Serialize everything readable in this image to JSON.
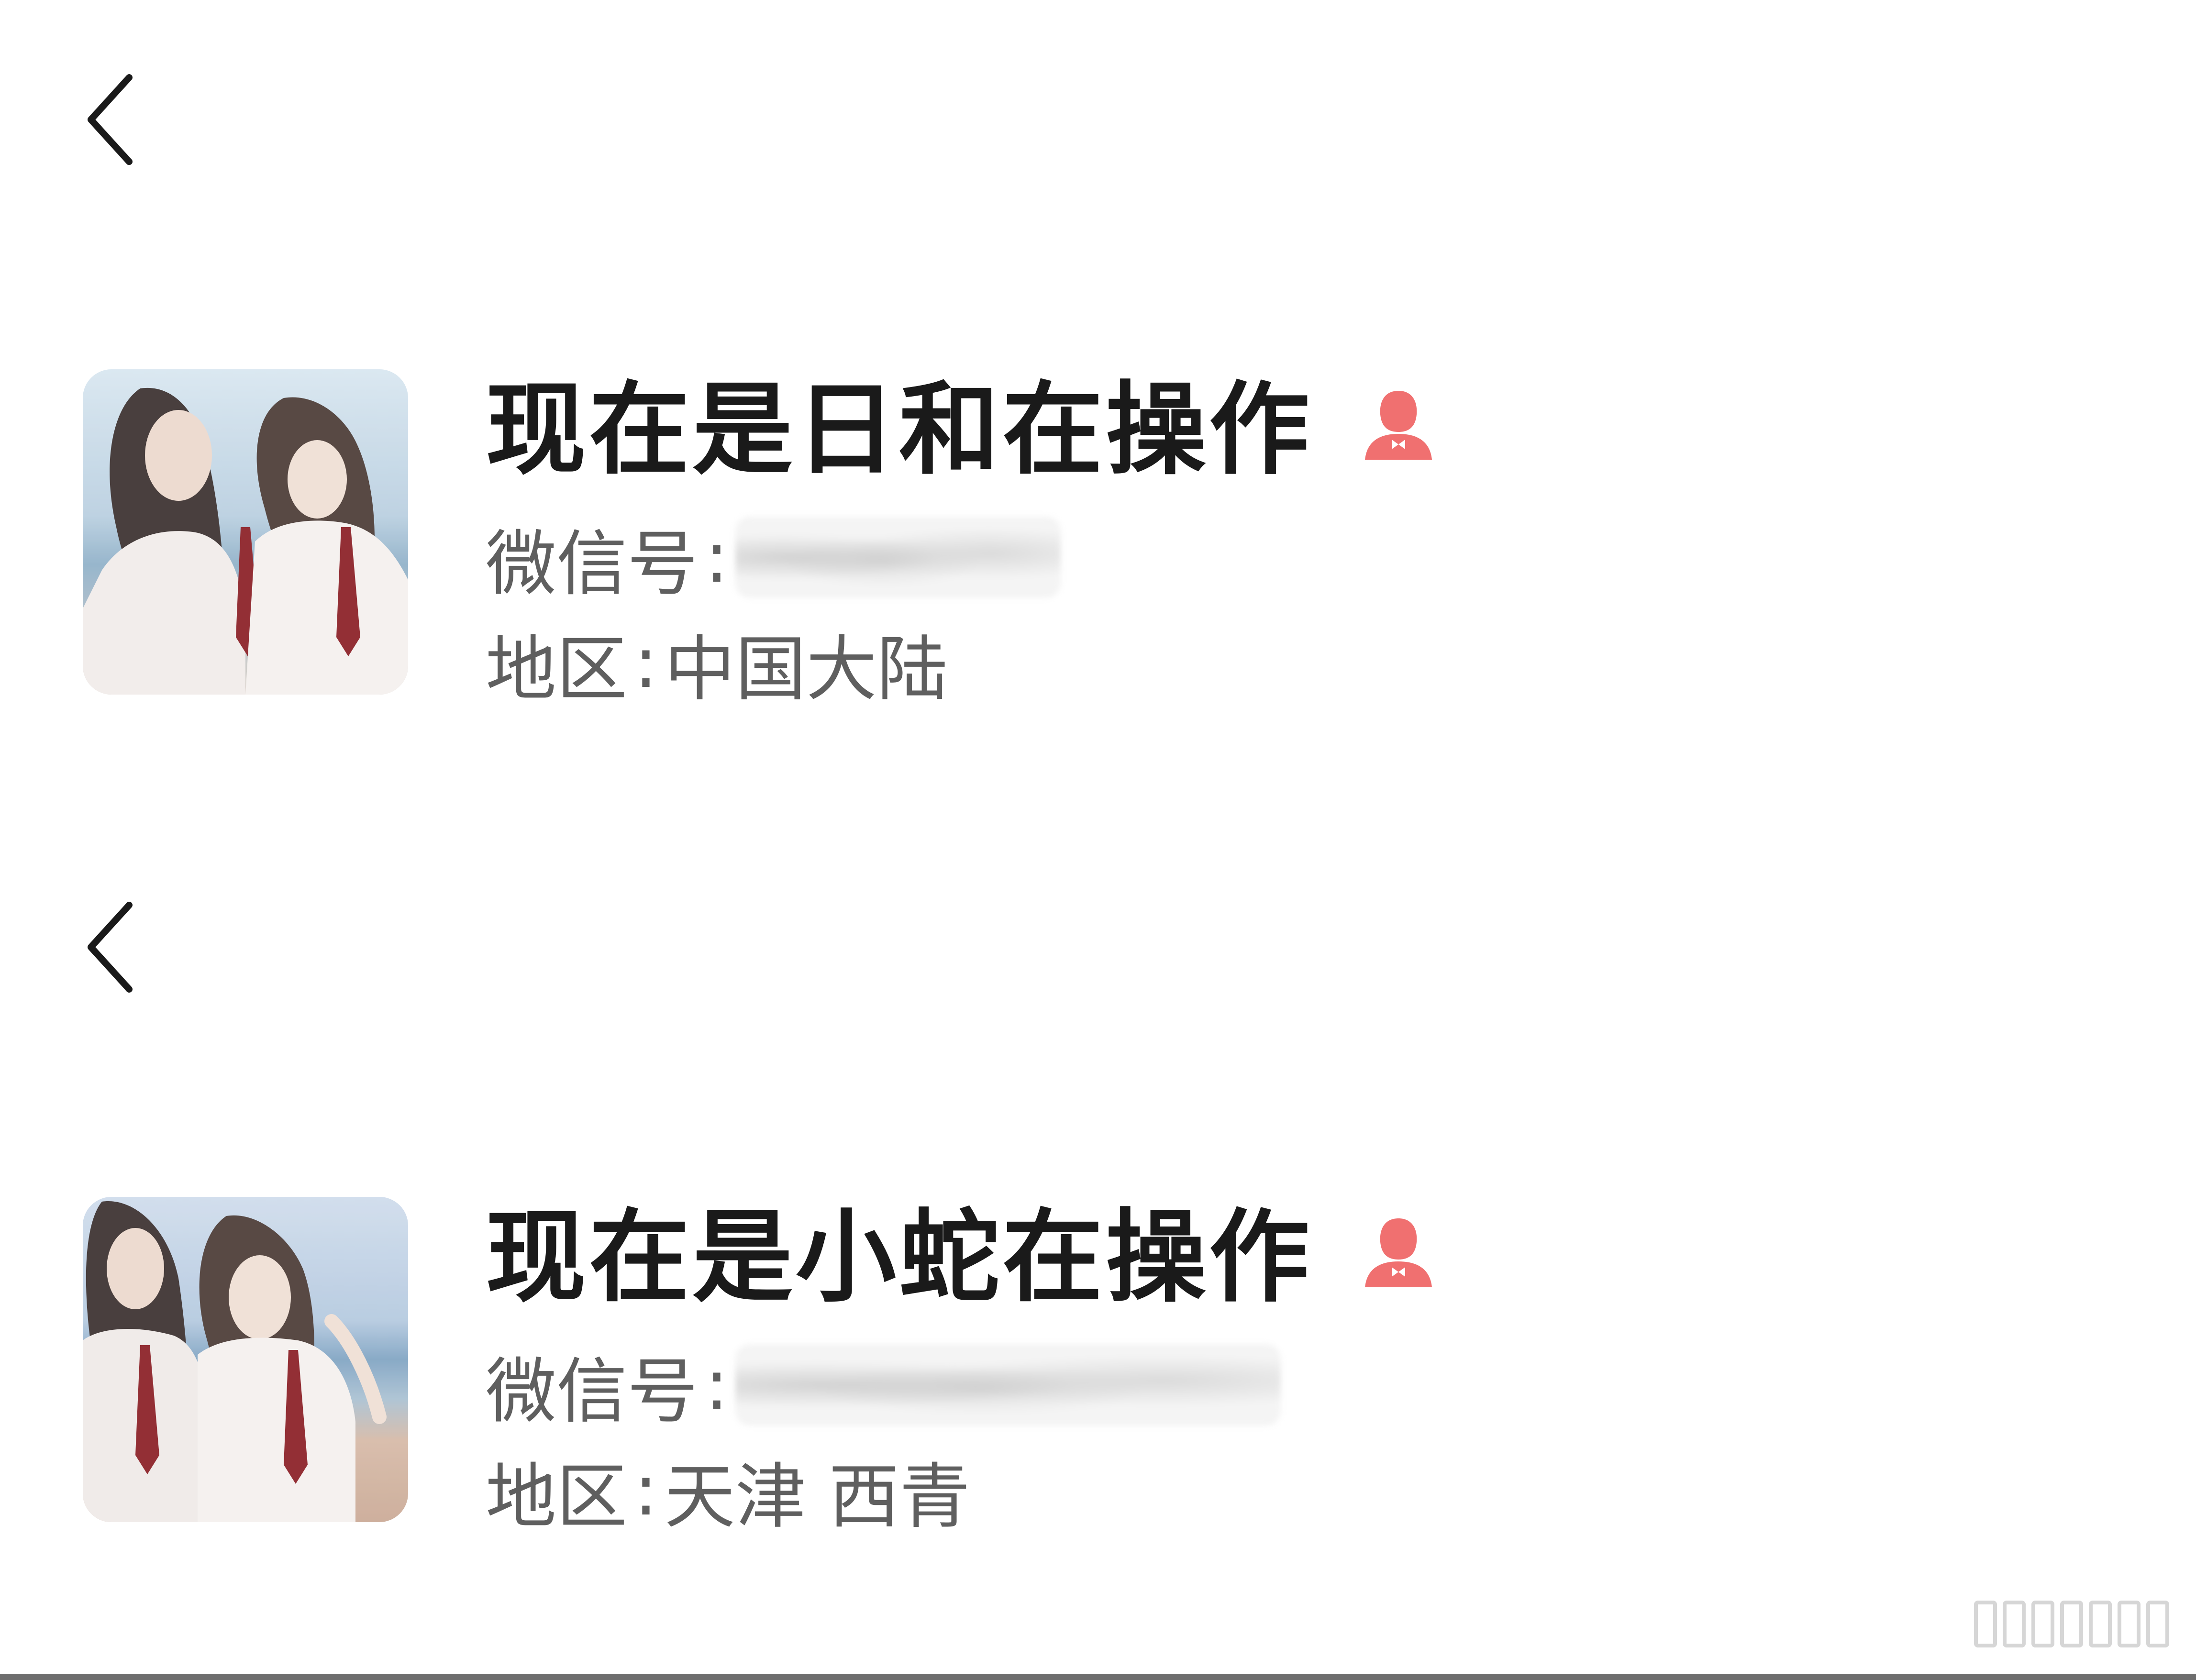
{
  "colors": {
    "background": "#ffffff",
    "name_text": "#1a1a1a",
    "info_text": "#5f5f5f",
    "gender_icon": "#f07070"
  },
  "profiles": [
    {
      "nickname": "现在是日和在操作",
      "gender_icon": "female-icon",
      "wechat_id_label": "微信号",
      "wechat_id_value": "",
      "region_label": "地区",
      "region_value": "中国大陆"
    },
    {
      "nickname": "现在是小蛇在操作",
      "gender_icon": "female-icon",
      "wechat_id_label": "微信号",
      "wechat_id_value": "",
      "region_label": "地区",
      "region_value": "天津 西青"
    }
  ],
  "separators": {
    "colon": ":"
  }
}
